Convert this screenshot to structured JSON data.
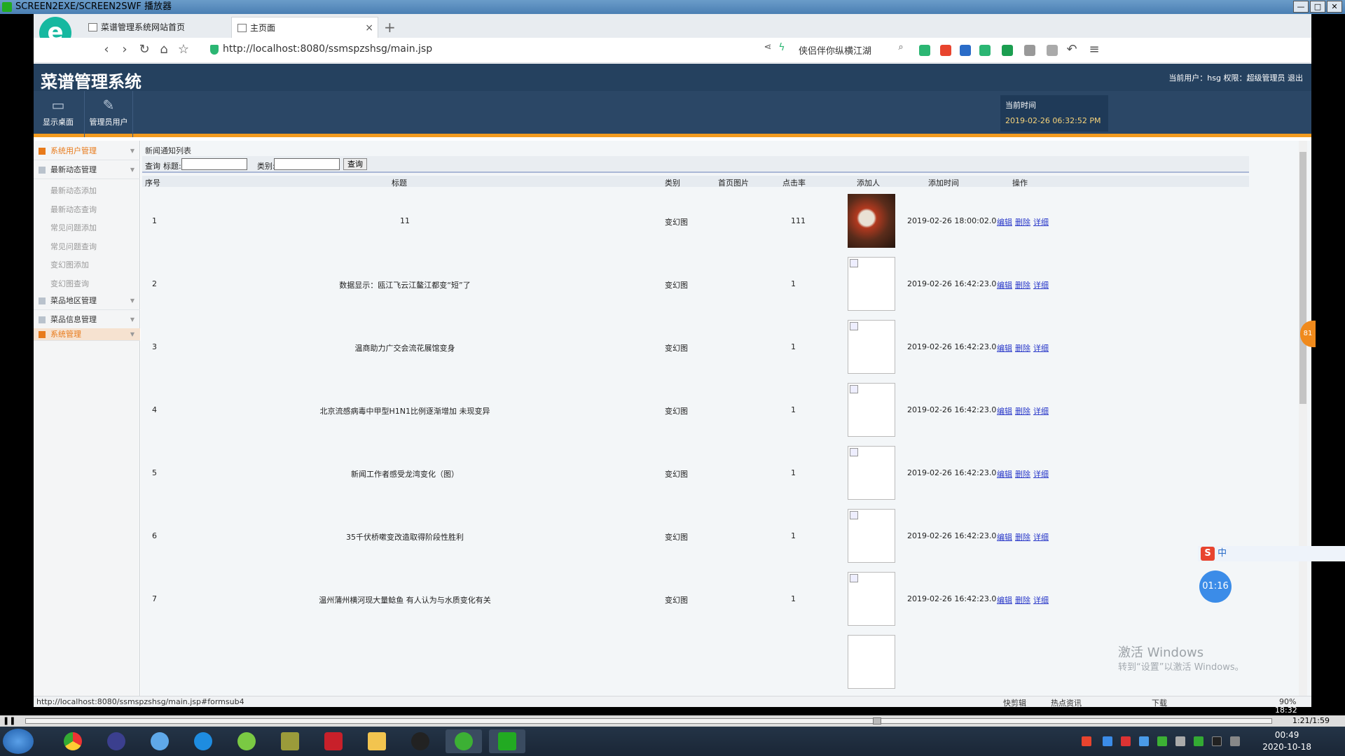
{
  "player": {
    "title": "SCREEN2EXE/SCREEN2SWF 播放器",
    "window_buttons": [
      "—",
      "□",
      "✕"
    ],
    "current_time": "1:21/1:59",
    "seek_progress": 0.68,
    "time_marker": "18:32"
  },
  "browser": {
    "tabs": [
      {
        "label": "菜谱管理系统网站首页",
        "active": false
      },
      {
        "label": "主页面",
        "active": true
      }
    ],
    "new_tab": "+",
    "tab_close": "×",
    "url": "http://localhost:8080/ssmspzshsg/main.jsp",
    "search_text": "侠侣伴你纵横江湖",
    "status_url": "http://localhost:8080/ssmspzshsg/main.jsp#formsub4",
    "status_right": [
      "快剪辑",
      "热点资讯",
      "下载",
      "90%"
    ]
  },
  "app": {
    "title": "菜谱管理系统",
    "user_info": "当前用户：hsg  权限：超级管理员  退出",
    "toolbar": [
      {
        "label": "显示桌面",
        "icon": "monitor-icon"
      },
      {
        "label": "管理员用户",
        "icon": "pencil-icon"
      }
    ],
    "time_label": "当前时间",
    "time_value": "2019-02-26 06:32:52 PM"
  },
  "sidebar": {
    "groups": [
      {
        "label": "系统用户管理",
        "highlight": true
      },
      {
        "label": "最新动态管理",
        "highlight": false
      },
      {
        "label": "菜品地区管理",
        "highlight": false
      },
      {
        "label": "菜品信息管理",
        "highlight": false
      },
      {
        "label": "系统管理",
        "highlight": true
      }
    ],
    "subitems": [
      "最新动态添加",
      "最新动态查询",
      "常见问题添加",
      "常见问题查询",
      "变幻图添加",
      "变幻图查询"
    ]
  },
  "main": {
    "list_title": "新闻通知列表",
    "query": {
      "label": "查询",
      "title_label": "标题:",
      "category_label": "类别:",
      "button": "查询",
      "title_value": "",
      "category_value": ""
    },
    "columns": [
      "序号",
      "标题",
      "类别",
      "首页图片",
      "点击率",
      "添加人",
      "添加时间",
      "操作"
    ],
    "ops": [
      "编辑",
      "删除",
      "详细"
    ],
    "rows": [
      {
        "no": "1",
        "title": "11",
        "category": "变幻图",
        "clicks": "111",
        "adder": "",
        "time": "2019-02-26 18:00:02.0",
        "photo": true
      },
      {
        "no": "2",
        "title": "数据显示：瓯江飞云江鳌江都变“短”了",
        "category": "变幻图",
        "clicks": "1",
        "adder": "",
        "time": "2019-02-26 16:42:23.0",
        "photo": false
      },
      {
        "no": "3",
        "title": "温商助力广交会流花展馆变身",
        "category": "变幻图",
        "clicks": "1",
        "adder": "",
        "time": "2019-02-26 16:42:23.0",
        "photo": false
      },
      {
        "no": "4",
        "title": "北京流感病毒中甲型H1N1比例逐渐增加 未现变异",
        "category": "变幻图",
        "clicks": "1",
        "adder": "",
        "time": "2019-02-26 16:42:23.0",
        "photo": false
      },
      {
        "no": "5",
        "title": "新闻工作者感受龙湾变化（图）",
        "category": "变幻图",
        "clicks": "1",
        "adder": "",
        "time": "2019-02-26 16:42:23.0",
        "photo": false
      },
      {
        "no": "6",
        "title": "35千伏桥嗽变改造取得阶段性胜利",
        "category": "变幻图",
        "clicks": "1",
        "adder": "",
        "time": "2019-02-26 16:42:23.0",
        "photo": false
      },
      {
        "no": "7",
        "title": "温州蒲州横河现大量鲶鱼 有人认为与水质变化有关",
        "category": "变幻图",
        "clicks": "1",
        "adder": "",
        "time": "2019-02-26 16:42:23.0",
        "photo": false
      }
    ]
  },
  "overlay": {
    "activate_title": "激活 Windows",
    "activate_sub": "转到“设置”以激活 Windows。",
    "timer": "01:16",
    "ime_lang": "中",
    "ime_logo": "S",
    "badge": "81"
  },
  "taskbar": {
    "clock_time": "00:49",
    "clock_date": "2020-10-18"
  },
  "colors": {
    "header": "#25415f",
    "accent": "#f39b1f",
    "link": "#2a39c9",
    "sidebar_highlight": "#e87a1a"
  }
}
